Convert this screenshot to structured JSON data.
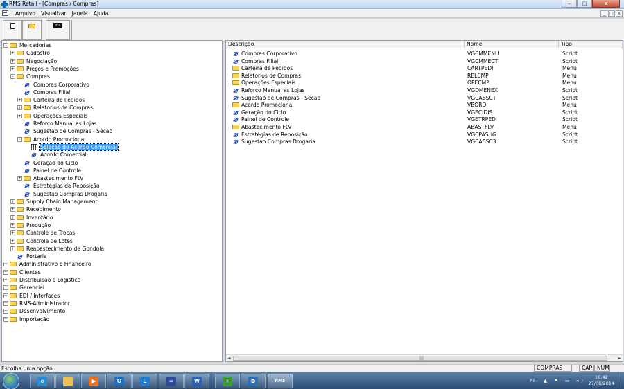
{
  "window": {
    "title": "RMS Retail - [Compras / Compras]",
    "buttons": {
      "minimize": "–",
      "maximize": "□",
      "close": "x"
    }
  },
  "menubar": {
    "items": [
      "Arquivo",
      "Visualizar",
      "Janela",
      "Ajuda"
    ],
    "mdi_buttons": {
      "minimize": "_",
      "restore": "□",
      "close": "x"
    }
  },
  "toolbar": {
    "f3_label": "F3"
  },
  "tree": [
    {
      "label": "Mercadorias",
      "icon": "folder",
      "level": 0,
      "expander": "-"
    },
    {
      "label": "Cadastro",
      "icon": "folder",
      "level": 1,
      "expander": "+"
    },
    {
      "label": "Negociação",
      "icon": "folder",
      "level": 1,
      "expander": "+"
    },
    {
      "label": "Preços e Promoções",
      "icon": "folder",
      "level": 1,
      "expander": "+"
    },
    {
      "label": "Compras",
      "icon": "folder",
      "level": 1,
      "expander": "-"
    },
    {
      "label": "Compras Corporativo",
      "icon": "script",
      "level": 2,
      "expander": ""
    },
    {
      "label": "Compras Filial",
      "icon": "script",
      "level": 2,
      "expander": ""
    },
    {
      "label": "Carteira de Pedidos",
      "icon": "folder",
      "level": 2,
      "expander": "+"
    },
    {
      "label": "Relatorios de Compras",
      "icon": "folder",
      "level": 2,
      "expander": "+"
    },
    {
      "label": "Operações Especiais",
      "icon": "folder",
      "level": 2,
      "expander": "+"
    },
    {
      "label": "Reforço Manual as Lojas",
      "icon": "script",
      "level": 2,
      "expander": ""
    },
    {
      "label": "Sugestao de Compras - Secao",
      "icon": "script",
      "level": 2,
      "expander": ""
    },
    {
      "label": "Acordo Promocional",
      "icon": "folder",
      "level": 2,
      "expander": "-"
    },
    {
      "label": "Seleção do Acordo Comercial",
      "icon": "grid",
      "level": 3,
      "expander": "",
      "selected": true
    },
    {
      "label": "Acordo Comercial",
      "icon": "script",
      "level": 3,
      "expander": ""
    },
    {
      "label": "Geração do Ciclo",
      "icon": "script",
      "level": 2,
      "expander": ""
    },
    {
      "label": "Painel de Controle",
      "icon": "script",
      "level": 2,
      "expander": ""
    },
    {
      "label": "Abastecimento FLV",
      "icon": "folder",
      "level": 2,
      "expander": "+"
    },
    {
      "label": "Estratégias de Reposição",
      "icon": "script",
      "level": 2,
      "expander": ""
    },
    {
      "label": "Sugestao Compras Drogaria",
      "icon": "script",
      "level": 2,
      "expander": ""
    },
    {
      "label": "Supply Chain Management",
      "icon": "folder",
      "level": 1,
      "expander": "+"
    },
    {
      "label": "Recebimento",
      "icon": "folder",
      "level": 1,
      "expander": "+"
    },
    {
      "label": "Inventário",
      "icon": "folder",
      "level": 1,
      "expander": "+"
    },
    {
      "label": "Produção",
      "icon": "folder",
      "level": 1,
      "expander": "+"
    },
    {
      "label": "Controle de Trocas",
      "icon": "folder",
      "level": 1,
      "expander": "+"
    },
    {
      "label": "Controle de Lotes",
      "icon": "folder",
      "level": 1,
      "expander": "+"
    },
    {
      "label": "Reabastecimento de Gondola",
      "icon": "folder",
      "level": 1,
      "expander": "+"
    },
    {
      "label": "Portaria",
      "icon": "script",
      "level": 1,
      "expander": ""
    },
    {
      "label": "Administrativo e Financeiro",
      "icon": "folder",
      "level": 0,
      "expander": "+"
    },
    {
      "label": "Clientes",
      "icon": "folder",
      "level": 0,
      "expander": "+"
    },
    {
      "label": "Distribuicao e Logistica",
      "icon": "folder",
      "level": 0,
      "expander": "+"
    },
    {
      "label": "Gerencial",
      "icon": "folder",
      "level": 0,
      "expander": "+"
    },
    {
      "label": "EDI / Interfaces",
      "icon": "folder",
      "level": 0,
      "expander": "+"
    },
    {
      "label": "RMS-Administrador",
      "icon": "folder",
      "level": 0,
      "expander": "+"
    },
    {
      "label": "Desenvolvimento",
      "icon": "folder",
      "level": 0,
      "expander": "+"
    },
    {
      "label": "Importação",
      "icon": "folder",
      "level": 0,
      "expander": "+"
    }
  ],
  "list": {
    "columns": [
      "Descrição",
      "Nome",
      "Tipo"
    ],
    "rows": [
      {
        "descricao": "Compras Corporativo",
        "nome": "VGCMMENU",
        "tipo": "Script",
        "icon": "script"
      },
      {
        "descricao": "Compras Filial",
        "nome": "VGCMMECT",
        "tipo": "Script",
        "icon": "script"
      },
      {
        "descricao": "Carteira de Pedidos",
        "nome": "CARTPEDI",
        "tipo": "Menu",
        "icon": "folder"
      },
      {
        "descricao": "Relatorios de Compras",
        "nome": "RELCMP",
        "tipo": "Menu",
        "icon": "folder"
      },
      {
        "descricao": "Operações Especiais",
        "nome": "OPECMP",
        "tipo": "Menu",
        "icon": "folder"
      },
      {
        "descricao": "Reforço Manual as Lojas",
        "nome": "VGDMENEX",
        "tipo": "Script",
        "icon": "script"
      },
      {
        "descricao": "Sugestao de Compras - Secao",
        "nome": "VGCABSCT",
        "tipo": "Script",
        "icon": "script"
      },
      {
        "descricao": "Acordo Promocional",
        "nome": "VBORD",
        "tipo": "Menu",
        "icon": "folder"
      },
      {
        "descricao": "Geração do Ciclo",
        "nome": "VGECIDIS",
        "tipo": "Script",
        "icon": "script"
      },
      {
        "descricao": "Painel de Controle",
        "nome": "VGETRPED",
        "tipo": "Script",
        "icon": "script"
      },
      {
        "descricao": "Abastecimento FLV",
        "nome": "ABASTFLV",
        "tipo": "Menu",
        "icon": "folder"
      },
      {
        "descricao": "Estratégias de Reposição",
        "nome": "VGCPASUG",
        "tipo": "Script",
        "icon": "script"
      },
      {
        "descricao": "Sugestao Compras Drogaria",
        "nome": "VGCABSC3",
        "tipo": "Script",
        "icon": "script"
      }
    ]
  },
  "statusbar": {
    "message": "Escolha uma opção",
    "panels": [
      "COMPRAS",
      "CAP",
      "NUM"
    ]
  },
  "taskbar": {
    "apps": [
      {
        "name": "internet-explorer-icon",
        "glyph": "e",
        "color": "#2a8ad4"
      },
      {
        "name": "file-explorer-icon",
        "glyph": "",
        "color": "#e9c25a"
      },
      {
        "name": "media-player-icon",
        "glyph": "▶",
        "color": "#e3762b"
      },
      {
        "name": "outlook-icon",
        "glyph": "O",
        "color": "#1f6fc0"
      },
      {
        "name": "lync-icon",
        "glyph": "L",
        "color": "#1d7bd2"
      },
      {
        "name": "remote-app-icon",
        "glyph": "∞",
        "color": "#2d4a9a"
      },
      {
        "name": "word-icon",
        "glyph": "W",
        "color": "#2b5fb0"
      },
      {
        "name": "tool-icon",
        "glyph": "+",
        "color": "#3b9a3a"
      },
      {
        "name": "network-icon",
        "glyph": "⊕",
        "color": "#2a6fb7"
      }
    ],
    "active_app": "RMS",
    "tray": {
      "lang": "PT",
      "time": "16:42",
      "date": "27/08/2014"
    }
  }
}
